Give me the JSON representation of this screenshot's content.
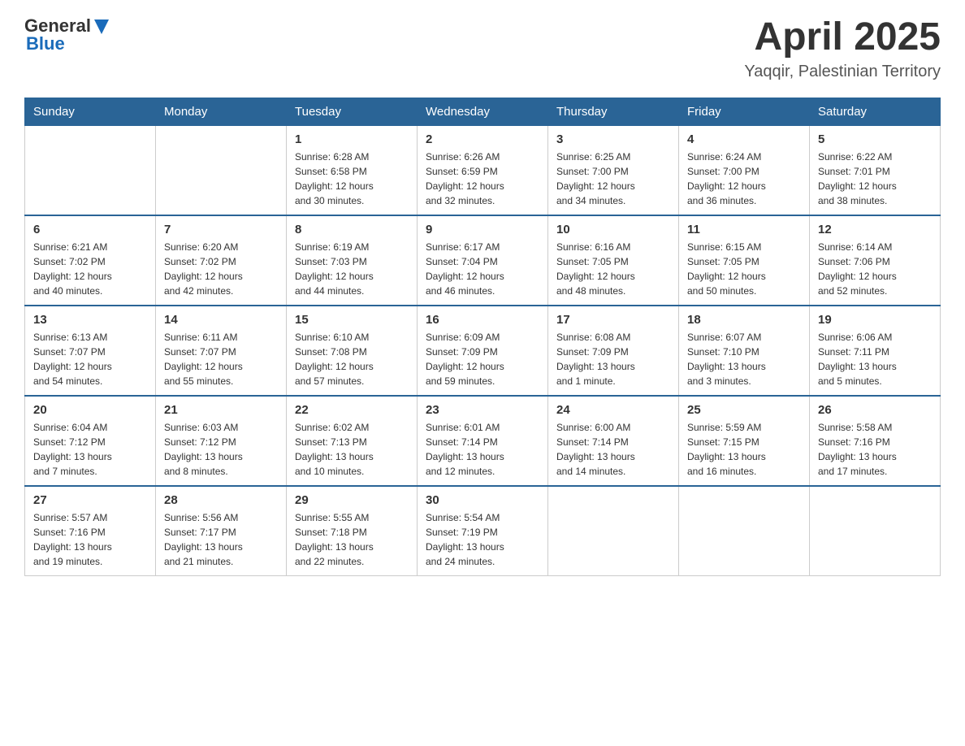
{
  "header": {
    "logo_general": "General",
    "logo_blue": "Blue",
    "month": "April 2025",
    "location": "Yaqqir, Palestinian Territory"
  },
  "days_of_week": [
    "Sunday",
    "Monday",
    "Tuesday",
    "Wednesday",
    "Thursday",
    "Friday",
    "Saturday"
  ],
  "weeks": [
    [
      {
        "day": "",
        "info": ""
      },
      {
        "day": "",
        "info": ""
      },
      {
        "day": "1",
        "info": "Sunrise: 6:28 AM\nSunset: 6:58 PM\nDaylight: 12 hours\nand 30 minutes."
      },
      {
        "day": "2",
        "info": "Sunrise: 6:26 AM\nSunset: 6:59 PM\nDaylight: 12 hours\nand 32 minutes."
      },
      {
        "day": "3",
        "info": "Sunrise: 6:25 AM\nSunset: 7:00 PM\nDaylight: 12 hours\nand 34 minutes."
      },
      {
        "day": "4",
        "info": "Sunrise: 6:24 AM\nSunset: 7:00 PM\nDaylight: 12 hours\nand 36 minutes."
      },
      {
        "day": "5",
        "info": "Sunrise: 6:22 AM\nSunset: 7:01 PM\nDaylight: 12 hours\nand 38 minutes."
      }
    ],
    [
      {
        "day": "6",
        "info": "Sunrise: 6:21 AM\nSunset: 7:02 PM\nDaylight: 12 hours\nand 40 minutes."
      },
      {
        "day": "7",
        "info": "Sunrise: 6:20 AM\nSunset: 7:02 PM\nDaylight: 12 hours\nand 42 minutes."
      },
      {
        "day": "8",
        "info": "Sunrise: 6:19 AM\nSunset: 7:03 PM\nDaylight: 12 hours\nand 44 minutes."
      },
      {
        "day": "9",
        "info": "Sunrise: 6:17 AM\nSunset: 7:04 PM\nDaylight: 12 hours\nand 46 minutes."
      },
      {
        "day": "10",
        "info": "Sunrise: 6:16 AM\nSunset: 7:05 PM\nDaylight: 12 hours\nand 48 minutes."
      },
      {
        "day": "11",
        "info": "Sunrise: 6:15 AM\nSunset: 7:05 PM\nDaylight: 12 hours\nand 50 minutes."
      },
      {
        "day": "12",
        "info": "Sunrise: 6:14 AM\nSunset: 7:06 PM\nDaylight: 12 hours\nand 52 minutes."
      }
    ],
    [
      {
        "day": "13",
        "info": "Sunrise: 6:13 AM\nSunset: 7:07 PM\nDaylight: 12 hours\nand 54 minutes."
      },
      {
        "day": "14",
        "info": "Sunrise: 6:11 AM\nSunset: 7:07 PM\nDaylight: 12 hours\nand 55 minutes."
      },
      {
        "day": "15",
        "info": "Sunrise: 6:10 AM\nSunset: 7:08 PM\nDaylight: 12 hours\nand 57 minutes."
      },
      {
        "day": "16",
        "info": "Sunrise: 6:09 AM\nSunset: 7:09 PM\nDaylight: 12 hours\nand 59 minutes."
      },
      {
        "day": "17",
        "info": "Sunrise: 6:08 AM\nSunset: 7:09 PM\nDaylight: 13 hours\nand 1 minute."
      },
      {
        "day": "18",
        "info": "Sunrise: 6:07 AM\nSunset: 7:10 PM\nDaylight: 13 hours\nand 3 minutes."
      },
      {
        "day": "19",
        "info": "Sunrise: 6:06 AM\nSunset: 7:11 PM\nDaylight: 13 hours\nand 5 minutes."
      }
    ],
    [
      {
        "day": "20",
        "info": "Sunrise: 6:04 AM\nSunset: 7:12 PM\nDaylight: 13 hours\nand 7 minutes."
      },
      {
        "day": "21",
        "info": "Sunrise: 6:03 AM\nSunset: 7:12 PM\nDaylight: 13 hours\nand 8 minutes."
      },
      {
        "day": "22",
        "info": "Sunrise: 6:02 AM\nSunset: 7:13 PM\nDaylight: 13 hours\nand 10 minutes."
      },
      {
        "day": "23",
        "info": "Sunrise: 6:01 AM\nSunset: 7:14 PM\nDaylight: 13 hours\nand 12 minutes."
      },
      {
        "day": "24",
        "info": "Sunrise: 6:00 AM\nSunset: 7:14 PM\nDaylight: 13 hours\nand 14 minutes."
      },
      {
        "day": "25",
        "info": "Sunrise: 5:59 AM\nSunset: 7:15 PM\nDaylight: 13 hours\nand 16 minutes."
      },
      {
        "day": "26",
        "info": "Sunrise: 5:58 AM\nSunset: 7:16 PM\nDaylight: 13 hours\nand 17 minutes."
      }
    ],
    [
      {
        "day": "27",
        "info": "Sunrise: 5:57 AM\nSunset: 7:16 PM\nDaylight: 13 hours\nand 19 minutes."
      },
      {
        "day": "28",
        "info": "Sunrise: 5:56 AM\nSunset: 7:17 PM\nDaylight: 13 hours\nand 21 minutes."
      },
      {
        "day": "29",
        "info": "Sunrise: 5:55 AM\nSunset: 7:18 PM\nDaylight: 13 hours\nand 22 minutes."
      },
      {
        "day": "30",
        "info": "Sunrise: 5:54 AM\nSunset: 7:19 PM\nDaylight: 13 hours\nand 24 minutes."
      },
      {
        "day": "",
        "info": ""
      },
      {
        "day": "",
        "info": ""
      },
      {
        "day": "",
        "info": ""
      }
    ]
  ]
}
